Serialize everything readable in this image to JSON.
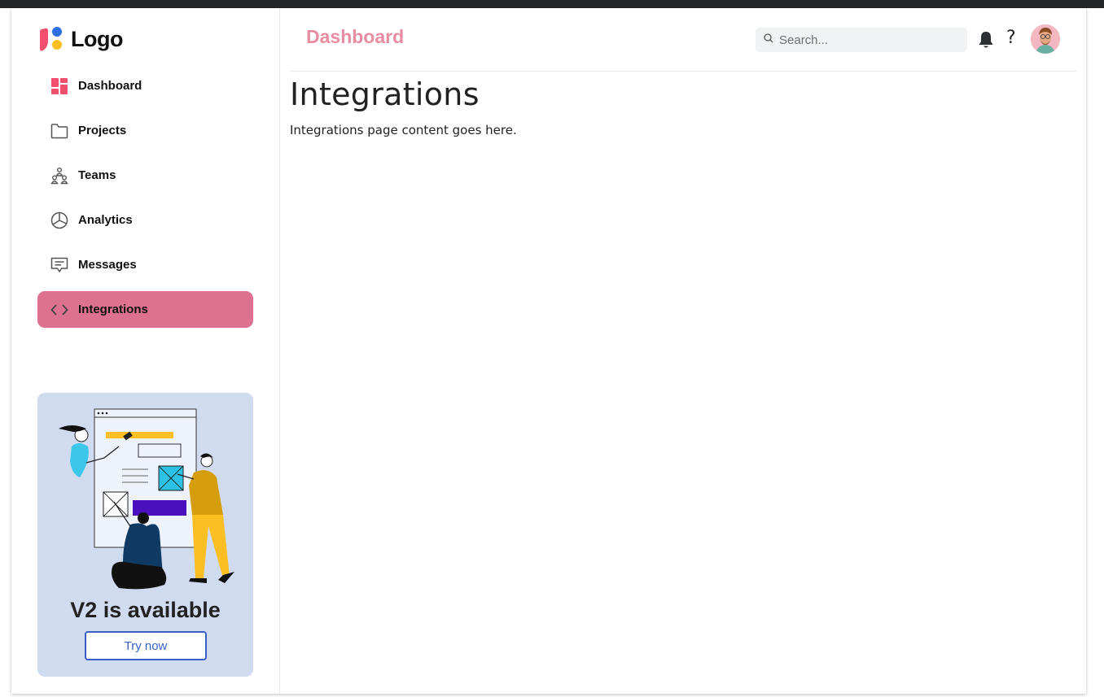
{
  "brand": {
    "logo_text": "Logo"
  },
  "sidebar": {
    "items": [
      {
        "label": "Dashboard",
        "icon": "dashboard-grid-icon",
        "active": false
      },
      {
        "label": "Projects",
        "icon": "folder-icon",
        "active": false
      },
      {
        "label": "Teams",
        "icon": "teams-icon",
        "active": false
      },
      {
        "label": "Analytics",
        "icon": "pie-chart-icon",
        "active": false
      },
      {
        "label": "Messages",
        "icon": "message-icon",
        "active": false
      },
      {
        "label": "Integrations",
        "icon": "code-icon",
        "active": true
      }
    ],
    "promo": {
      "title": "V2 is available",
      "button_label": "Try now"
    }
  },
  "header": {
    "title": "Dashboard",
    "search": {
      "placeholder": "Search...",
      "value": ""
    },
    "help_label": "?"
  },
  "main": {
    "title": "Integrations",
    "text": "Integrations page content goes here."
  },
  "colors": {
    "accent_pink": "#dc7190",
    "header_title": "#e88ca1",
    "promo_bg": "#d0dbf0",
    "promo_button": "#3760c4"
  }
}
